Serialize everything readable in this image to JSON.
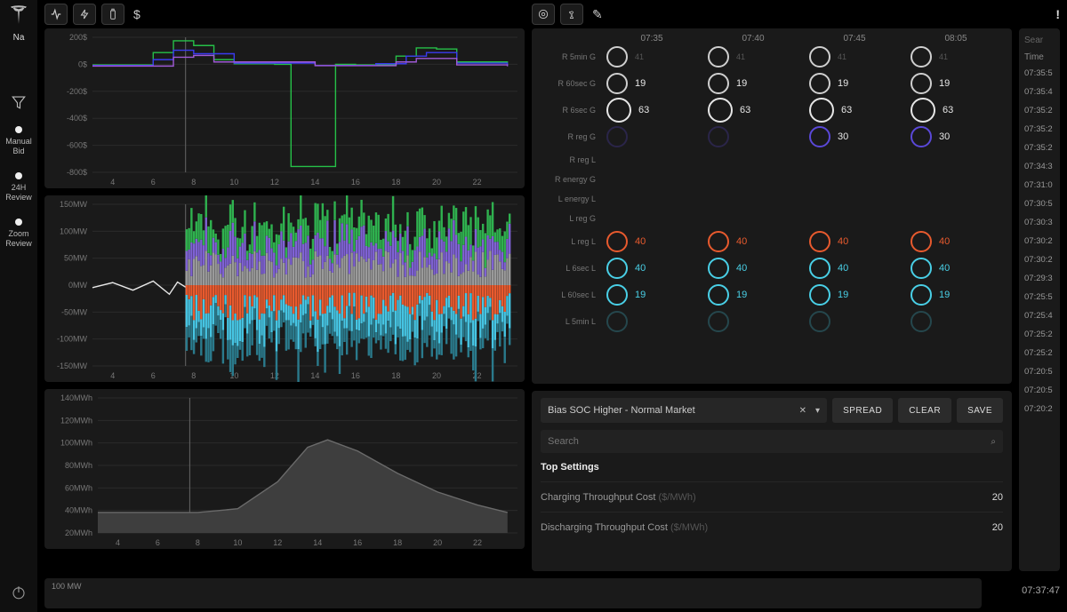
{
  "rail": {
    "brand_label": "Na",
    "items": [
      {
        "label": "Manual\nBid"
      },
      {
        "label": "24H\nReview"
      },
      {
        "label": "Zoom\nReview"
      }
    ]
  },
  "left_toolbar_glyph": "$",
  "chart_data": [
    {
      "type": "line",
      "title": "",
      "xlabel": "",
      "ylabel": "$",
      "x_ticks": [
        4,
        6,
        8,
        10,
        12,
        14,
        16,
        18,
        20,
        22
      ],
      "y_ticks": [
        "200$",
        "0$",
        "-200$",
        "-400$",
        "-600$",
        "-800$"
      ],
      "ylim": [
        -900,
        250
      ],
      "day_marker_x": 7.6,
      "series": [
        {
          "name": "green",
          "color": "#26c048",
          "x": [
            3,
            6,
            7,
            8,
            9,
            10,
            12,
            12.8,
            12.81,
            15,
            15.01,
            16,
            18,
            19,
            20,
            21,
            23.5
          ],
          "y": [
            15,
            120,
            220,
            180,
            60,
            25,
            20,
            20,
            -850,
            -850,
            20,
            15,
            90,
            160,
            150,
            40,
            10
          ]
        },
        {
          "name": "blue",
          "color": "#3a3af0",
          "x": [
            3,
            6,
            7,
            8,
            10,
            14,
            17,
            18.5,
            19.5,
            21,
            23.5
          ],
          "y": [
            10,
            60,
            140,
            110,
            30,
            10,
            25,
            90,
            120,
            30,
            5
          ]
        },
        {
          "name": "purple",
          "color": "#a05ad6",
          "x": [
            3,
            7,
            8,
            9,
            14,
            18,
            19,
            21,
            23.5
          ],
          "y": [
            5,
            80,
            95,
            40,
            8,
            40,
            70,
            15,
            3
          ]
        }
      ]
    },
    {
      "type": "stacked-bar-updown",
      "title": "",
      "xlabel": "",
      "ylabel": "MW",
      "x_ticks": [
        4,
        6,
        8,
        10,
        12,
        14,
        16,
        18,
        20,
        22
      ],
      "y_ticks": [
        "150MW",
        "100MW",
        "50MW",
        "0MW",
        "-50MW",
        "-100MW",
        "-150MW"
      ],
      "ylim": [
        -160,
        160
      ],
      "day_marker_x": 7.6,
      "baseline_series": {
        "name": "white",
        "color": "#e7e7e7",
        "x": [
          3,
          4,
          5,
          6,
          6.8,
          7.2,
          7.6
        ],
        "y": [
          -5,
          5,
          -10,
          8,
          -18,
          6,
          -4
        ]
      },
      "up_colors": [
        "#9a9a9a",
        "#7f62d4",
        "#2fb24f"
      ],
      "down_colors": [
        "#e85a2e",
        "#46c5e3",
        "#2a7a8c"
      ]
    },
    {
      "type": "area",
      "title": "",
      "xlabel": "",
      "ylabel": "MWh",
      "x_ticks": [
        4,
        6,
        8,
        10,
        12,
        14,
        16,
        18,
        20,
        22
      ],
      "y_ticks": [
        "140MWh",
        "120MWh",
        "100MWh",
        "80MWh",
        "60MWh",
        "40MWh",
        "20MWh"
      ],
      "ylim": [
        0,
        145
      ],
      "day_marker_x": 7.6,
      "series": [
        {
          "name": "soc",
          "color": "#4a4a4a",
          "x": [
            3,
            8,
            10,
            12,
            13.5,
            14.5,
            16,
            18,
            20,
            22,
            23.5
          ],
          "y": [
            22,
            22,
            26,
            55,
            92,
            100,
            88,
            64,
            44,
            30,
            22
          ]
        }
      ]
    }
  ],
  "circle_grid": {
    "col_headers": [
      "07:35",
      "07:40",
      "07:45",
      "08:05"
    ],
    "rows": [
      {
        "label": "R 5min G",
        "color": "#cfcfcf",
        "cells": [
          {
            "v": "41",
            "faint": true
          },
          {
            "v": "41",
            "faint": true
          },
          {
            "v": "41",
            "faint": true
          },
          {
            "v": "41",
            "faint": true
          }
        ]
      },
      {
        "label": "R 60sec G",
        "color": "#cfcfcf",
        "cells": [
          {
            "v": "19"
          },
          {
            "v": "19"
          },
          {
            "v": "19"
          },
          {
            "v": "19"
          }
        ]
      },
      {
        "label": "R 6sec G",
        "color": "#e6e6e6",
        "big": true,
        "cells": [
          {
            "v": "63"
          },
          {
            "v": "63"
          },
          {
            "v": "63"
          },
          {
            "v": "63"
          }
        ]
      },
      {
        "label": "R reg G",
        "color": "#5a48d8",
        "cells": [
          {
            "v": ""
          },
          {
            "v": ""
          },
          {
            "v": "30"
          },
          {
            "v": "30"
          }
        ]
      },
      {
        "label": "R reg L",
        "empty": true
      },
      {
        "label": "R energy G",
        "empty": true
      },
      {
        "label": "L energy L",
        "empty": true
      },
      {
        "label": "L reg G",
        "empty": true
      },
      {
        "label": "L reg L",
        "color": "#e85a2e",
        "valcolor": "#e85a2e",
        "cells": [
          {
            "v": "40"
          },
          {
            "v": "40"
          },
          {
            "v": "40"
          },
          {
            "v": "40"
          }
        ]
      },
      {
        "label": "L 6sec L",
        "color": "#49cfe6",
        "valcolor": "#49cfe6",
        "cells": [
          {
            "v": "40"
          },
          {
            "v": "40"
          },
          {
            "v": "40"
          },
          {
            "v": "40"
          }
        ]
      },
      {
        "label": "L 60sec L",
        "color": "#49cfe6",
        "valcolor": "#49cfe6",
        "cells": [
          {
            "v": "19"
          },
          {
            "v": "19"
          },
          {
            "v": "19"
          },
          {
            "v": "19"
          }
        ]
      },
      {
        "label": "L 5min L",
        "color": "#49cfe6",
        "valcolor": "#49cfe6",
        "cells": [
          {
            "v": ""
          },
          {
            "v": ""
          },
          {
            "v": ""
          },
          {
            "v": ""
          }
        ]
      }
    ]
  },
  "settings": {
    "selector_text": "Bias SOC Higher - Normal Market",
    "buttons": {
      "spread": "SPREAD",
      "clear": "CLEAR",
      "save": "SAVE"
    },
    "search_placeholder": "Search",
    "section_title": "Top Settings",
    "rows": [
      {
        "label": "Charging Throughput Cost",
        "unit": "($/MWh)",
        "value": "20"
      },
      {
        "label": "Discharging Throughput Cost",
        "unit": "($/MWh)",
        "value": "20"
      }
    ]
  },
  "events": {
    "search_label": "Sear",
    "header": "Time",
    "times": [
      "07:35:5",
      "07:35:4",
      "07:35:2",
      "07:35:2",
      "07:35:2",
      "07:34:3",
      "07:31:0",
      "07:30:5",
      "07:30:3",
      "07:30:2",
      "07:30:2",
      "07:29:3",
      "07:25:5",
      "07:25:4",
      "07:25:2",
      "07:25:2",
      "07:20:5",
      "07:20:5",
      "07:20:2"
    ]
  },
  "footer": {
    "label": "100 MW"
  },
  "clock": "07:37:47"
}
